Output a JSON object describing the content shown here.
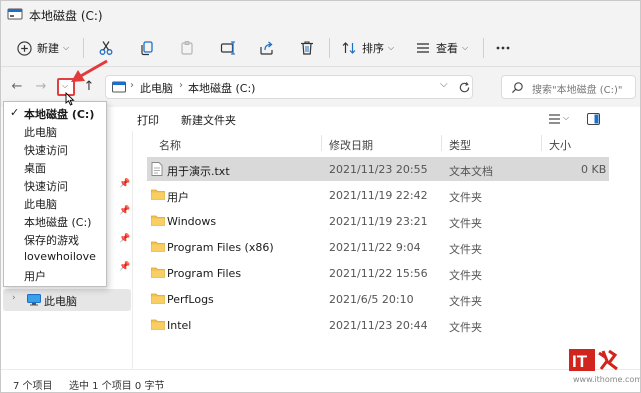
{
  "window": {
    "title": "本地磁盘 (C:)",
    "accent": "#1e6fc8",
    "folder_color": "#f4c04f"
  },
  "commandbar": {
    "new_label": "新建",
    "sort_label": "排序",
    "view_label": "查看",
    "icons": [
      "cut-icon",
      "copy-icon",
      "paste-icon",
      "rename-icon",
      "share-icon",
      "delete-icon",
      "more-icon"
    ]
  },
  "address": {
    "crumbs": [
      "此电脑",
      "本地磁盘 (C:)"
    ],
    "search_placeholder": "搜索\"本地磁盘 (C:)\""
  },
  "subbar": {
    "print": "打印",
    "new_folder": "新建文件夹"
  },
  "history": {
    "items": [
      {
        "label": "本地磁盘 (C:)",
        "current": true
      },
      {
        "label": "此电脑"
      },
      {
        "label": "快速访问"
      },
      {
        "label": "桌面"
      },
      {
        "label": "快速访问"
      },
      {
        "label": "此电脑"
      },
      {
        "label": "本地磁盘 (C:)"
      },
      {
        "label": "保存的游戏"
      },
      {
        "label": "lovewhoilove"
      },
      {
        "label": "用户"
      }
    ]
  },
  "nav": {
    "this_pc": "此电脑"
  },
  "columns": {
    "name": "名称",
    "modified": "修改日期",
    "type": "类型",
    "size": "大小"
  },
  "files": [
    {
      "name": "用于演示.txt",
      "modified": "2021/11/23 20:55",
      "type": "文本文档",
      "size": "0 KB",
      "kind": "text",
      "selected": true
    },
    {
      "name": "用户",
      "modified": "2021/11/19 22:42",
      "type": "文件夹",
      "size": "",
      "kind": "folder"
    },
    {
      "name": "Windows",
      "modified": "2021/11/19 23:21",
      "type": "文件夹",
      "size": "",
      "kind": "folder"
    },
    {
      "name": "Program Files (x86)",
      "modified": "2021/11/22 9:04",
      "type": "文件夹",
      "size": "",
      "kind": "folder"
    },
    {
      "name": "Program Files",
      "modified": "2021/11/22 15:56",
      "type": "文件夹",
      "size": "",
      "kind": "folder"
    },
    {
      "name": "PerfLogs",
      "modified": "2021/6/5 20:10",
      "type": "文件夹",
      "size": "",
      "kind": "folder"
    },
    {
      "name": "Intel",
      "modified": "2021/11/23 20:44",
      "type": "文件夹",
      "size": "",
      "kind": "folder"
    }
  ],
  "status": {
    "count": "7 个项目",
    "selection": "选中 1 个项目 0 字节"
  },
  "watermark": {
    "logo": "IT之家",
    "url": "www.ithome.com"
  }
}
